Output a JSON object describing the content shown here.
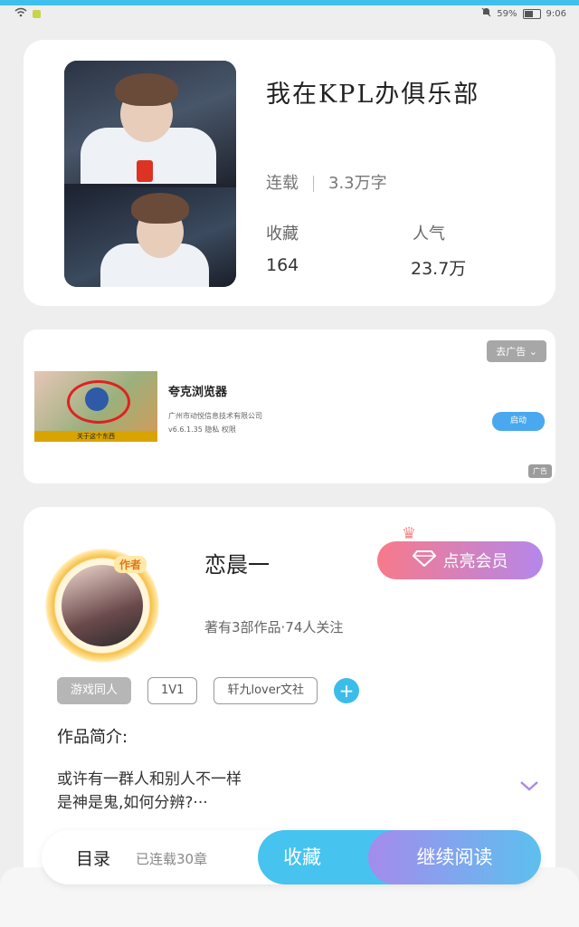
{
  "status_bar": {
    "battery": "59%",
    "time": "9:06"
  },
  "book": {
    "title": "我在KPL办俱乐部",
    "status": "连载",
    "word_count": "3.3万字",
    "collect_label": "收藏",
    "collect_value": "164",
    "popularity_label": "人气",
    "popularity_value": "23.7万"
  },
  "ad": {
    "tag": "去广告",
    "title": "夸克浏览器",
    "company": "广州市动悦信息技术有限公司",
    "meta": "v6.6.1.35  隐私  权限",
    "button": "启动",
    "ad_mark": "广告",
    "image_caption": "关于这个东西"
  },
  "author": {
    "badge": "作者",
    "name": "恋晨一",
    "info": "著有3部作品·74人关注",
    "vip_button": "点亮会员"
  },
  "tags": [
    "游戏同人",
    "1V1",
    "轩九lover文社"
  ],
  "intro": {
    "label": "作品简介:",
    "line1": "或许有一群人和别人不一样",
    "line2": "是神是鬼,如何分辨?···"
  },
  "bottom": {
    "toc": "目录",
    "toc_sub": "已连载30章",
    "collect": "收藏",
    "read": "继续阅读"
  }
}
